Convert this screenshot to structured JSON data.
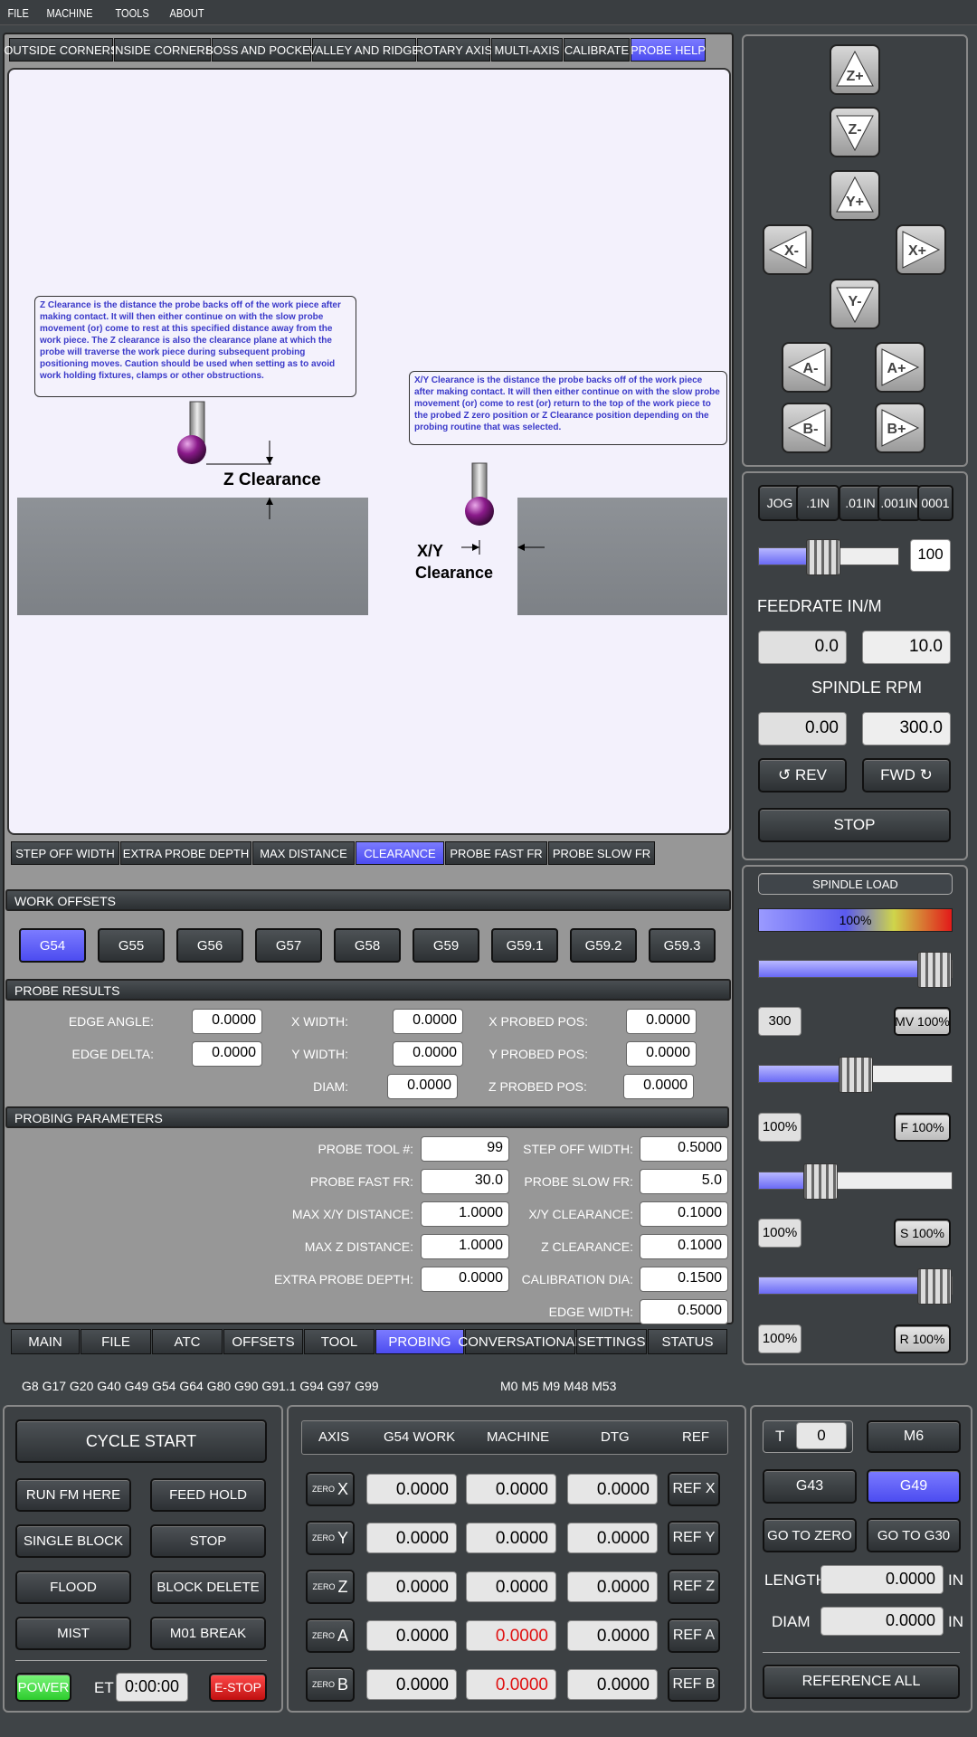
{
  "menu": [
    "FILE",
    "MACHINE",
    "TOOLS",
    "ABOUT"
  ],
  "top_tabs": [
    {
      "label": "OUTSIDE CORNERS",
      "active": false
    },
    {
      "label": "INSIDE CORNERS",
      "active": false
    },
    {
      "label": "BOSS AND POCKET",
      "active": false
    },
    {
      "label": "VALLEY AND RIDGE",
      "active": false
    },
    {
      "label": "ROTARY AXIS",
      "active": false
    },
    {
      "label": "MULTI-AXIS",
      "active": false
    },
    {
      "label": "CALIBRATE",
      "active": false
    },
    {
      "label": "PROBE HELP",
      "active": true
    }
  ],
  "help": {
    "z_note": "Z Clearance is the distance the probe backs off of the work piece after making contact.  It will then either continue on with the slow probe movement (or) come to rest at this specified distance away from the work piece.  The Z clearance is also the clearance plane at which the probe will traverse the work piece during subsequent probing positioning moves.  Caution should be used when setting as to avoid work holding fixtures, clamps or other obstructions.",
    "xy_note": "X/Y Clearance is the distance the probe backs off of the work piece after making contact.  It will then either continue on with the slow probe movement (or) come to rest (or) return to the top of the work piece to the probed Z zero position or Z Clearance position depending on the probing routine that was selected.",
    "z_label": "Z Clearance",
    "xy_label_1": "X/Y",
    "xy_label_2": "Clearance"
  },
  "help_tabs": [
    {
      "label": "STEP OFF WIDTH",
      "active": false
    },
    {
      "label": "EXTRA PROBE DEPTH",
      "active": false
    },
    {
      "label": "MAX DISTANCE",
      "active": false
    },
    {
      "label": "CLEARANCE",
      "active": true
    },
    {
      "label": "PROBE FAST FR",
      "active": false
    },
    {
      "label": "PROBE SLOW FR",
      "active": false
    }
  ],
  "work_offsets": {
    "title": "WORK OFFSETS",
    "items": [
      {
        "label": "G54",
        "active": true
      },
      {
        "label": "G55",
        "active": false
      },
      {
        "label": "G56",
        "active": false
      },
      {
        "label": "G57",
        "active": false
      },
      {
        "label": "G58",
        "active": false
      },
      {
        "label": "G59",
        "active": false
      },
      {
        "label": "G59.1",
        "active": false
      },
      {
        "label": "G59.2",
        "active": false
      },
      {
        "label": "G59.3",
        "active": false
      }
    ]
  },
  "probe_results": {
    "title": "PROBE RESULTS",
    "edge_angle_label": "EDGE ANGLE:",
    "edge_angle": "0.0000",
    "edge_delta_label": "EDGE DELTA:",
    "edge_delta": "0.0000",
    "x_width_label": "X WIDTH:",
    "x_width": "0.0000",
    "y_width_label": "Y WIDTH:",
    "y_width": "0.0000",
    "diam_label": "DIAM:",
    "diam": "0.0000",
    "x_probed_label": "X PROBED POS:",
    "x_probed": "0.0000",
    "y_probed_label": "Y PROBED POS:",
    "y_probed": "0.0000",
    "z_probed_label": "Z PROBED POS:",
    "z_probed": "0.0000"
  },
  "probing_parameters": {
    "title": "PROBING PARAMETERS",
    "probe_tool_label": "PROBE TOOL #:",
    "probe_tool": "99",
    "fast_fr_label": "PROBE FAST FR:",
    "fast_fr": "30.0",
    "max_xy_label": "MAX X/Y DISTANCE:",
    "max_xy": "1.0000",
    "max_z_label": "MAX Z DISTANCE:",
    "max_z": "1.0000",
    "extra_depth_label": "EXTRA PROBE DEPTH:",
    "extra_depth": "0.0000",
    "step_off_label": "STEP OFF WIDTH:",
    "step_off": "0.5000",
    "slow_fr_label": "PROBE SLOW FR:",
    "slow_fr": "5.0",
    "xy_clear_label": "X/Y CLEARANCE:",
    "xy_clear": "0.1000",
    "z_clear_label": "Z CLEARANCE:",
    "z_clear": "0.1000",
    "cal_dia_label": "CALIBRATION DIA:",
    "cal_dia": "0.1500",
    "edge_width_label": "EDGE WIDTH:",
    "edge_width": "0.5000"
  },
  "bottom_tabs": [
    {
      "label": "MAIN",
      "active": false
    },
    {
      "label": "FILE",
      "active": false
    },
    {
      "label": "ATC",
      "active": false
    },
    {
      "label": "OFFSETS",
      "active": false
    },
    {
      "label": "TOOL",
      "active": false
    },
    {
      "label": "PROBING",
      "active": true
    },
    {
      "label": "CONVERSATIONAL",
      "active": false
    },
    {
      "label": "SETTINGS",
      "active": false
    },
    {
      "label": "STATUS",
      "active": false
    }
  ],
  "status": {
    "gcodes": "G8 G17 G20 G40 G49 G54 G64 G80 G90 G91.1 G94 G97 G99",
    "mcodes": "M0 M5 M9 M48 M53"
  },
  "jog": {
    "buttons": [
      "Z+",
      "Z-",
      "Y+",
      "X-",
      "X+",
      "Y-",
      "A-",
      "A+",
      "B-",
      "B+"
    ],
    "increments": [
      "JOG",
      ".1IN",
      ".01IN",
      ".001IN",
      "0001"
    ],
    "slider_value": "100",
    "slider_fraction": 0.45
  },
  "feed": {
    "title": "FEEDRATE IN/M",
    "actual": "0.0",
    "set": "10.0"
  },
  "spindle": {
    "title": "SPINDLE RPM",
    "actual": "0.00",
    "set": "300.0",
    "rev": "REV",
    "fwd": "FWD",
    "stop": "STOP"
  },
  "overrides": {
    "title": "SPINDLE LOAD",
    "load_pct": "100%",
    "mv_value": "300",
    "mv_label": "MV 100%",
    "mv_fraction": 1.0,
    "f_value": "100%",
    "f_label": "F 100%",
    "f_fraction": 0.5,
    "s_value": "100%",
    "s_label": "S 100%",
    "s_fraction": 0.28,
    "r_value": "100%",
    "r_label": "R 100%",
    "r_fraction": 1.0
  },
  "controls": {
    "cycle_start": "CYCLE START",
    "run_from_here": "RUN FM HERE",
    "feed_hold": "FEED HOLD",
    "single_block": "SINGLE BLOCK",
    "stop": "STOP",
    "flood": "FLOOD",
    "block_delete": "BLOCK DELETE",
    "mist": "MIST",
    "m01_break": "M01 BREAK",
    "power": "POWER",
    "et_label": "ET",
    "et": "0:00:00",
    "estop": "E-STOP"
  },
  "dro": {
    "headers": [
      "AXIS",
      "G54 WORK",
      "MACHINE",
      "DTG",
      "REF"
    ],
    "zero_label": "ZERO",
    "rows": [
      {
        "axis": "X",
        "work": "0.0000",
        "machine": "0.0000",
        "dtg": "0.0000",
        "ref": "REF X",
        "machine_red": false
      },
      {
        "axis": "Y",
        "work": "0.0000",
        "machine": "0.0000",
        "dtg": "0.0000",
        "ref": "REF Y",
        "machine_red": false
      },
      {
        "axis": "Z",
        "work": "0.0000",
        "machine": "0.0000",
        "dtg": "0.0000",
        "ref": "REF Z",
        "machine_red": false
      },
      {
        "axis": "A",
        "work": "0.0000",
        "machine": "0.0000",
        "dtg": "0.0000",
        "ref": "REF A",
        "machine_red": true
      },
      {
        "axis": "B",
        "work": "0.0000",
        "machine": "0.0000",
        "dtg": "0.0000",
        "ref": "REF B",
        "machine_red": true
      }
    ]
  },
  "tool": {
    "t_label": "T",
    "t_value": "0",
    "m6": "M6",
    "g43": "G43",
    "g49": "G49",
    "go_zero": "GO TO ZERO",
    "go_g30": "GO TO G30",
    "length_label": "LENGTH",
    "length": "0.0000",
    "diam_label": "DIAM",
    "diam": "0.0000",
    "unit": "IN",
    "ref_all": "REFERENCE ALL"
  }
}
